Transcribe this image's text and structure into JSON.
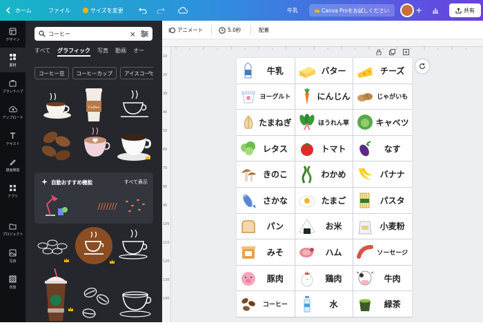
{
  "topbar": {
    "home": "ホーム",
    "file": "ファイル",
    "resize": "サイズを変更",
    "doc_title": "牛乳",
    "pro_cta": "Canva Proをお試しください",
    "share": "共有"
  },
  "rail": [
    {
      "label": "デザイン",
      "icon": "design-icon"
    },
    {
      "label": "素材",
      "icon": "elements-icon"
    },
    {
      "label": "ブランドハブ",
      "icon": "brand-icon"
    },
    {
      "label": "アップロード",
      "icon": "upload-icon"
    },
    {
      "label": "テキスト",
      "icon": "text-icon"
    },
    {
      "label": "描画機能",
      "icon": "draw-icon"
    },
    {
      "label": "アプリ",
      "icon": "apps-icon"
    },
    {
      "label": "プロジェクト",
      "icon": "folder-icon"
    },
    {
      "label": "写真",
      "icon": "photo-icon"
    },
    {
      "label": "背景",
      "icon": "background-icon"
    }
  ],
  "panel": {
    "search_value": "コーヒー",
    "tabs": [
      "すべて",
      "グラフィック",
      "写真",
      "動画",
      "オー"
    ],
    "chips": [
      "コーヒー豆",
      "コーヒーカップ",
      "アイスコーヒ"
    ],
    "promo_title": "自動おすすめ機能",
    "promo_link": "すべて表示"
  },
  "toolbar": {
    "animate": "アニメート",
    "duration": "5.0秒",
    "position": "配置"
  },
  "ruler": [
    "10",
    "20",
    "30",
    "40",
    "50",
    "60",
    "70",
    "80",
    "90",
    "100",
    "110",
    "120",
    "130",
    "140"
  ],
  "cells": [
    {
      "label": "牛乳",
      "icon": "milk-carton-icon"
    },
    {
      "label": "バター",
      "icon": "butter-icon"
    },
    {
      "label": "チーズ",
      "icon": "cheese-icon"
    },
    {
      "label": "ヨーグルト",
      "icon": "yogurt-icon"
    },
    {
      "label": "にんじん",
      "icon": "carrot-icon"
    },
    {
      "label": "じゃがいも",
      "icon": "potato-icon"
    },
    {
      "label": "たまねぎ",
      "icon": "onion-icon"
    },
    {
      "label": "ほうれん草",
      "icon": "spinach-icon"
    },
    {
      "label": "キャベツ",
      "icon": "cabbage-icon"
    },
    {
      "label": "レタス",
      "icon": "lettuce-icon"
    },
    {
      "label": "トマト",
      "icon": "tomato-icon"
    },
    {
      "label": "なす",
      "icon": "eggplant-icon"
    },
    {
      "label": "きのこ",
      "icon": "mushroom-icon"
    },
    {
      "label": "わかめ",
      "icon": "seaweed-icon"
    },
    {
      "label": "バナナ",
      "icon": "banana-icon"
    },
    {
      "label": "さかな",
      "icon": "fish-icon"
    },
    {
      "label": "たまご",
      "icon": "egg-icon"
    },
    {
      "label": "パスタ",
      "icon": "pasta-icon"
    },
    {
      "label": "パン",
      "icon": "bread-icon"
    },
    {
      "label": "お米",
      "icon": "rice-ball-icon"
    },
    {
      "label": "小麦粉",
      "icon": "flour-icon"
    },
    {
      "label": "みそ",
      "icon": "miso-icon"
    },
    {
      "label": "ハム",
      "icon": "ham-icon"
    },
    {
      "label": "ソーセージ",
      "icon": "sausage-icon"
    },
    {
      "label": "豚肉",
      "icon": "pig-icon"
    },
    {
      "label": "鶏肉",
      "icon": "chicken-icon"
    },
    {
      "label": "牛肉",
      "icon": "cow-icon"
    },
    {
      "label": "コーヒー",
      "icon": "coffee-beans-icon"
    },
    {
      "label": "水",
      "icon": "water-bottle-icon"
    },
    {
      "label": "緑茶",
      "icon": "green-tea-icon"
    }
  ],
  "colors": {
    "topbar_start": "#16b6c6",
    "topbar_end": "#6b3fe0",
    "panel_bg": "#25272c",
    "rail_bg": "#0f1014",
    "canvas_bg": "#edeef1"
  }
}
